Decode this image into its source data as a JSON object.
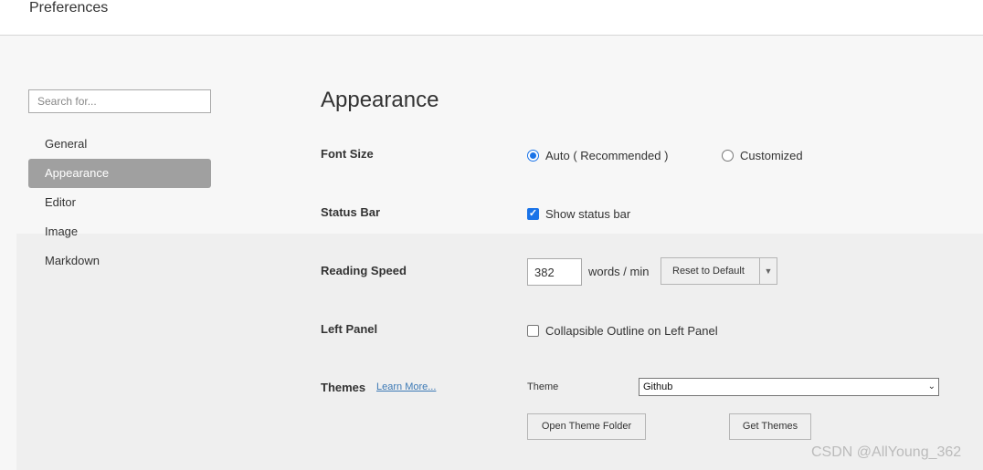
{
  "window": {
    "title": "Preferences"
  },
  "sidebar": {
    "search_placeholder": "Search for...",
    "items": [
      {
        "label": "General",
        "active": false
      },
      {
        "label": "Appearance",
        "active": true
      },
      {
        "label": "Editor",
        "active": false
      },
      {
        "label": "Image",
        "active": false
      },
      {
        "label": "Markdown",
        "active": false
      }
    ]
  },
  "main": {
    "title": "Appearance",
    "font_size": {
      "label": "Font Size",
      "options": [
        {
          "label": "Auto ( Recommended )",
          "selected": true
        },
        {
          "label": "Customized",
          "selected": false
        }
      ]
    },
    "status_bar": {
      "label": "Status Bar",
      "checkbox_label": "Show status bar",
      "checked": true
    },
    "reading_speed": {
      "label": "Reading Speed",
      "value": "382",
      "unit": "words / min",
      "reset_label": "Reset to Default"
    },
    "left_panel": {
      "label": "Left Panel",
      "checkbox_label": "Collapsible Outline on Left Panel",
      "checked": false
    },
    "themes": {
      "label": "Themes",
      "learn_more": "Learn More...",
      "theme_label": "Theme",
      "selected_theme": "Github",
      "open_folder_label": "Open Theme Folder",
      "get_themes_label": "Get Themes"
    }
  },
  "watermark": "CSDN @AllYoung_362",
  "colors": {
    "accent": "#1a73e8",
    "active_nav_bg": "#a0a0a0",
    "link": "#3c79b5"
  }
}
